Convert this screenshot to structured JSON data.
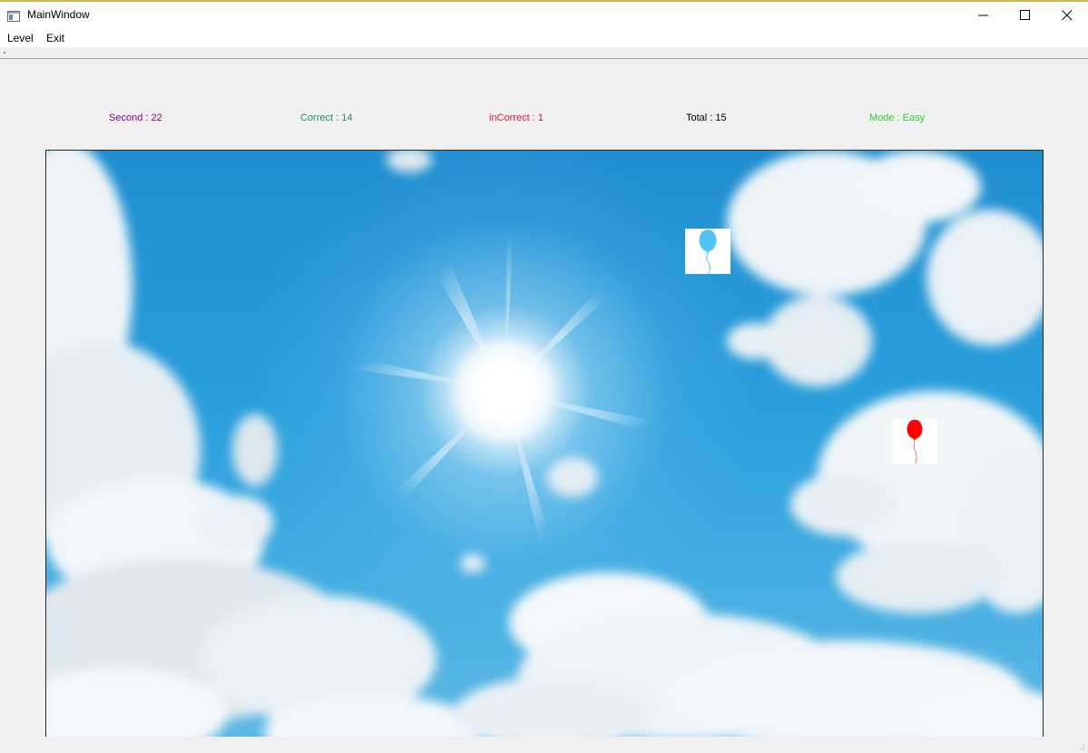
{
  "window": {
    "title": "MainWindow",
    "icon": "app-window-icon",
    "controls": [
      "minimize-icon",
      "maximize-icon",
      "close-icon"
    ]
  },
  "menu": {
    "level": "Level",
    "exit": "Exit"
  },
  "stats": {
    "second": "Second : 22",
    "correct": "Correct : 14",
    "incorrect": "inCorrect : 1",
    "total": "Total : 15",
    "mode": "Mode : Easy"
  },
  "colors": {
    "second": "#8b008b",
    "correct": "#2e8b57",
    "incorrect": "#dc143c",
    "total": "#000000",
    "mode": "#32cd32",
    "balloon_blue": "#4fc3f7",
    "balloon_red": "#ff0000"
  },
  "game": {
    "background": "sunny sky with clouds",
    "balloons": [
      {
        "color": "blue",
        "icon": "blue-balloon-icon"
      },
      {
        "color": "red",
        "icon": "red-balloon-icon"
      }
    ]
  }
}
